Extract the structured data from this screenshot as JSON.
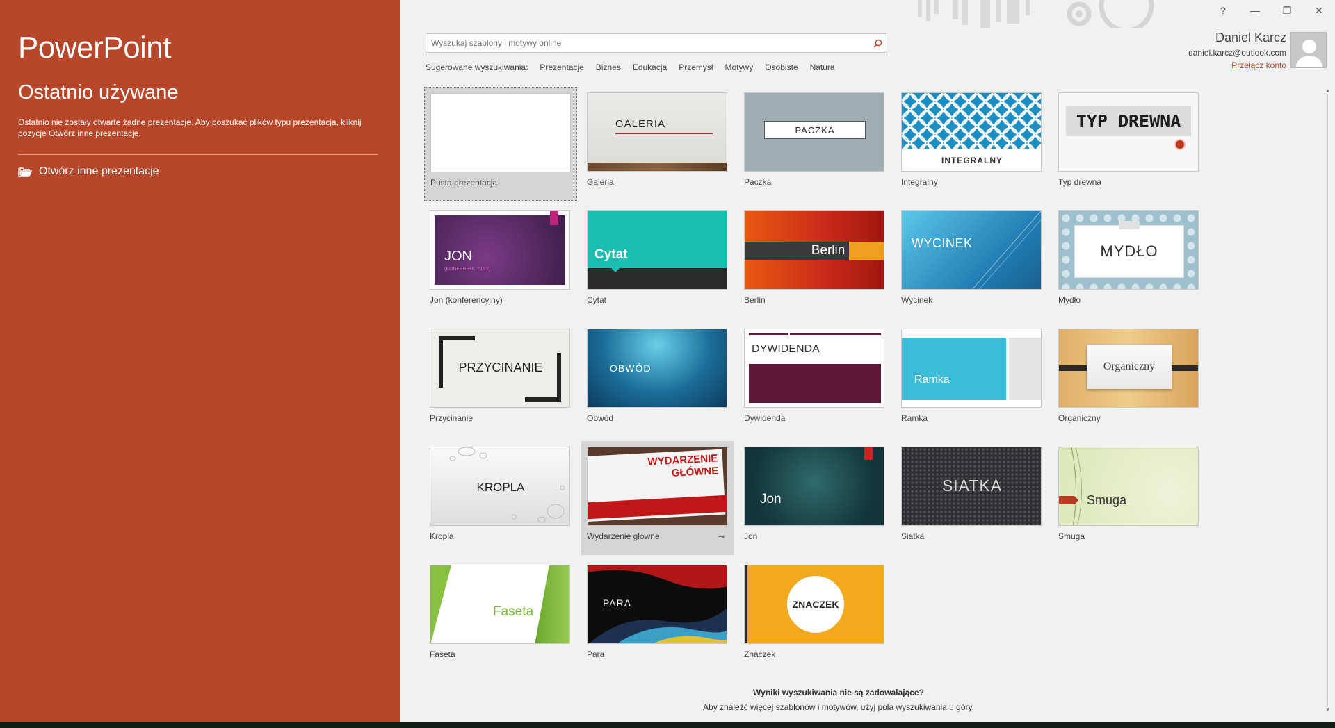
{
  "app": {
    "title": "PowerPoint",
    "recent_title": "Ostatnio używane",
    "recent_desc": "Ostatnio nie zostały otwarte żadne prezentacje. Aby poszukać plików typu prezentacja,  kliknij pozycję Otwórz inne prezentacje.",
    "open_other": "Otwórz inne prezentacje"
  },
  "window": {
    "help": "?",
    "minimize": "—",
    "restore": "❐",
    "close": "✕"
  },
  "search": {
    "placeholder": "Wyszukaj szablony i motywy online",
    "value": ""
  },
  "suggested": {
    "label": "Sugerowane wyszukiwania:",
    "items": [
      "Prezentacje",
      "Biznes",
      "Edukacja",
      "Przemysł",
      "Motywy",
      "Osobiste",
      "Natura"
    ]
  },
  "account": {
    "name": "Daniel Karcz",
    "email": "daniel.karcz@outlook.com",
    "switch": "Przełącz konto"
  },
  "templates": [
    {
      "label": "Pusta prezentacja",
      "thumb_text": ""
    },
    {
      "label": "Galeria",
      "thumb_text": "GALERIA"
    },
    {
      "label": "Paczka",
      "thumb_text": "PACZKA"
    },
    {
      "label": "Integralny",
      "thumb_text": "INTEGRALNY"
    },
    {
      "label": "Typ drewna",
      "thumb_text": "TYP DREWNA"
    },
    {
      "label": "Jon (konferencyjny)",
      "thumb_text": "JON",
      "thumb_sub": "(KONFERENCYJNY)"
    },
    {
      "label": "Cytat",
      "thumb_text": "Cytat"
    },
    {
      "label": "Berlin",
      "thumb_text": "Berlin"
    },
    {
      "label": "Wycinek",
      "thumb_text": "WYCINEK"
    },
    {
      "label": "Mydło",
      "thumb_text": "MYDŁO"
    },
    {
      "label": "Przycinanie",
      "thumb_text": "PRZYCINANIE"
    },
    {
      "label": "Obwód",
      "thumb_text": "OBWÓD"
    },
    {
      "label": "Dywidenda",
      "thumb_text": "DYWIDENDA"
    },
    {
      "label": "Ramka",
      "thumb_text": "Ramka"
    },
    {
      "label": "Organiczny",
      "thumb_text": "Organiczny"
    },
    {
      "label": "Kropla",
      "thumb_text": "KROPLA"
    },
    {
      "label": "Wydarzenie główne",
      "thumb_text": "WYDARZENIE",
      "thumb_sub": "GŁÓWNE"
    },
    {
      "label": "Jon",
      "thumb_text": "Jon"
    },
    {
      "label": "Siatka",
      "thumb_text": "SIATKA"
    },
    {
      "label": "Smuga",
      "thumb_text": "Smuga"
    },
    {
      "label": "Faseta",
      "thumb_text": "Faseta"
    },
    {
      "label": "Para",
      "thumb_text": "PARA"
    },
    {
      "label": "Znaczek",
      "thumb_text": "ZNACZEK"
    }
  ],
  "footer": {
    "bold": "Wyniki wyszukiwania nie są zadowalające?",
    "sub": "Aby znaleźć więcej szablonów i motywów, użyj pola wyszukiwania u góry."
  },
  "icons": {
    "search": "search-icon",
    "folder": "folder-open-icon",
    "pin": "pin-icon",
    "avatar": "avatar-icon"
  },
  "colors": {
    "accent": "#b7472a",
    "background": "#f1f1f1"
  }
}
